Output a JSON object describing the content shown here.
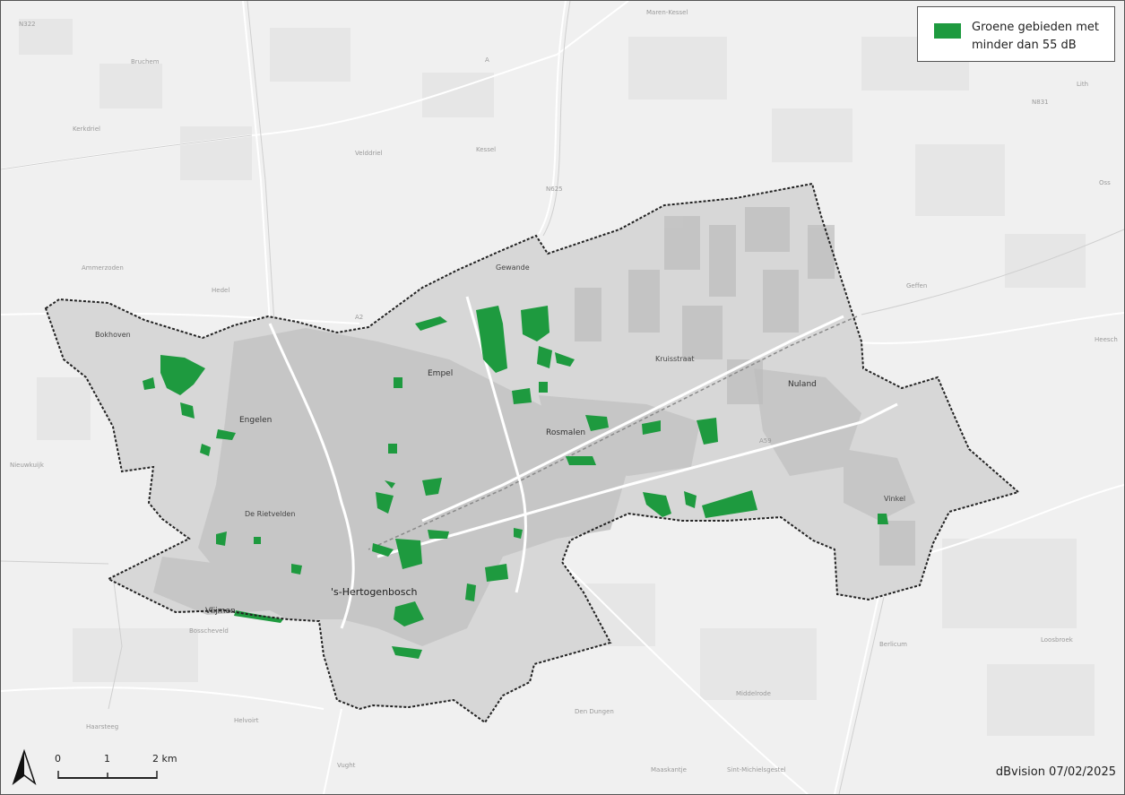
{
  "legend": {
    "label": "Groene gebieden met minder dan 55 dB",
    "swatch_color": "#1e9a3f"
  },
  "scale": {
    "unit": "km",
    "tick_0": "0",
    "tick_1": "1",
    "tick_2": "2 km"
  },
  "credit": "dBvision 07/02/2025",
  "north_arrow_icon": "north-arrow-icon",
  "colors": {
    "basemap": "#f0f0f0",
    "municipality_fill": "#d7d7d7",
    "urban_fill": "#c4c4c4",
    "green_area": "#1e9a3f",
    "boundary": "#222222"
  },
  "places": {
    "engelen": "Engelen",
    "empel": "Empel",
    "rosmalen": "Rosmalen",
    "nuland": "Nuland",
    "kruisstraat": "Kruisstraat",
    "vinkel": "Vinkel",
    "den_bosch": "'s-Hertogenbosch",
    "vlijmen": "Vlijmen",
    "bokhoven": "Bokhoven",
    "gewande": "Gewande",
    "de_rietvelden": "De Rietvelden",
    "heesch": "Heesch",
    "kerkdriel": "Kerkdriel",
    "velddriel": "Velddriel",
    "kessel": "Kessel",
    "vught": "Vught",
    "den_dungen": "Den Dungen",
    "maaskantje": "Maaskantje",
    "sint_michielsgestel": "Sint-Michielsgestel",
    "bruchem": "Bruchem",
    "hedel": "Hedel",
    "oss": "Oss",
    "nieuwkuijk": "Nieuwkuijk",
    "ammerzoden": "Ammerzoden",
    "lith": "Lith",
    "maren_kessel": "Maren-Kessel",
    "haarsteeg": "Haarsteeg",
    "geffen": "Geffen",
    "loosbroek": "Loosbroek",
    "middelrode": "Middelrode",
    "berlicum": "Berlicum",
    "helvoirt": "Helvoirt",
    "bosscheveld": "Bosscheveld",
    "a2": "A2",
    "a59": "A59",
    "n322": "N322",
    "n625": "N625",
    "n831": "N831",
    "a": "A"
  }
}
